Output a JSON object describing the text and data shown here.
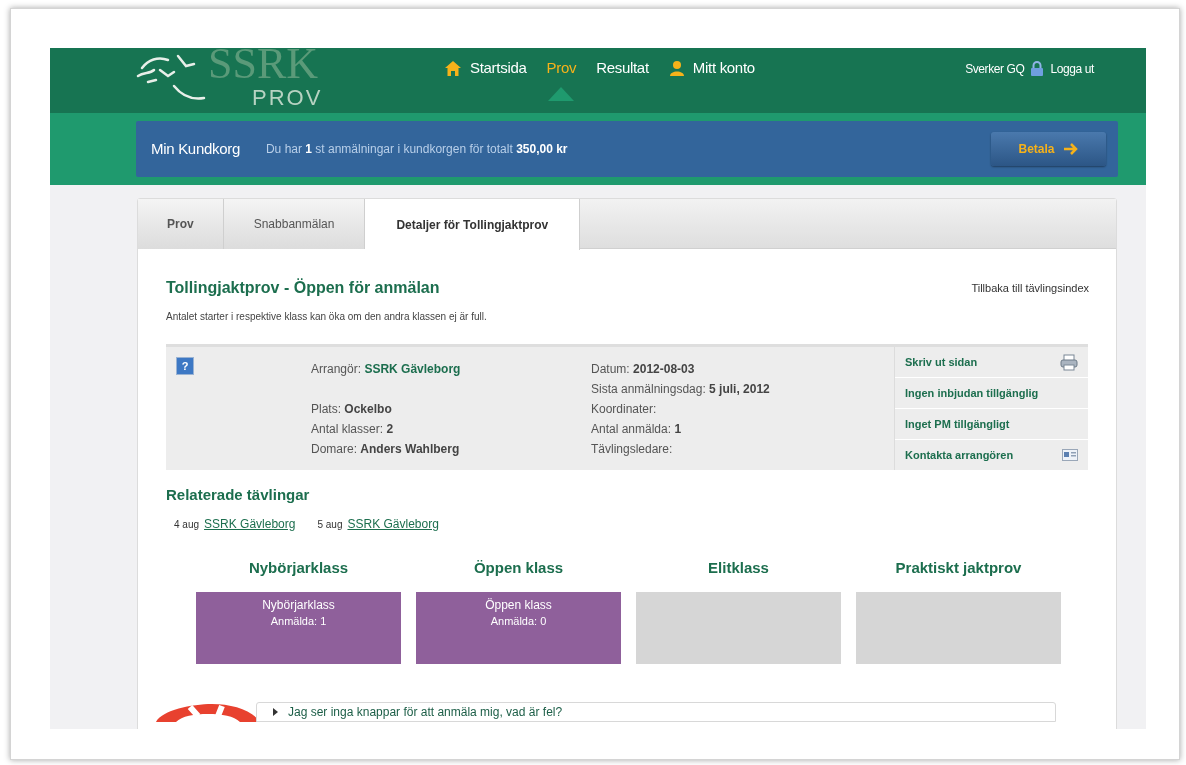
{
  "header": {
    "logo": {
      "title": "SSRK",
      "subtitle": "PROV"
    },
    "nav": [
      {
        "label": "Startsida",
        "kind": "home",
        "selected": false
      },
      {
        "label": "Prov",
        "kind": "plain",
        "selected": true
      },
      {
        "label": "Resultat",
        "kind": "plain",
        "selected": false
      },
      {
        "label": "Mitt konto",
        "kind": "account",
        "selected": false
      }
    ],
    "user": {
      "name": "Sverker GQ",
      "logout": "Logga ut"
    }
  },
  "cart": {
    "title": "Min Kundkorg",
    "message": "Du har **1** st anmälningar i kundkorgen för totalt **350,00 kr**",
    "button": "Betala"
  },
  "tabs": [
    {
      "label": "Prov",
      "selected": false
    },
    {
      "label": "Snabbanmälan",
      "selected": false
    },
    {
      "label": "Detaljer för Tollingjaktprov",
      "selected": true
    }
  ],
  "details": {
    "title": "Tollingjaktprov - Öppen för anmälan",
    "back_link": "Tillbaka till tävlingsindex",
    "note": "Antalet starter i respektive klass kan öka om den andra klassen ej är full.",
    "help_icon": "?",
    "left_fields": [
      {
        "label": "Arrangör:",
        "value": "SSRK Gävleborg",
        "kind": "link"
      },
      {
        "kind": "spacer"
      },
      {
        "label": "Plats:",
        "value": "Ockelbo",
        "kind": "text"
      },
      {
        "label": "Antal klasser:",
        "value": "2",
        "kind": "text"
      },
      {
        "label": "Domare:",
        "value": "Anders Wahlberg",
        "kind": "text"
      }
    ],
    "right_fields": [
      {
        "label": "Datum:",
        "value": "2012-08-03"
      },
      {
        "label": "Sista anmälningsdag:",
        "value": "5 juli, 2012"
      },
      {
        "label": "Koordinater:"
      },
      {
        "label": "Antal anmälda:",
        "value": "1"
      },
      {
        "label": "Tävlingsledare:"
      }
    ],
    "actions": [
      {
        "label": "Skriv ut sidan",
        "kind": "print"
      },
      {
        "label": "Ingen inbjudan tillgänglig",
        "kind": "plain"
      },
      {
        "label": "Inget PM tillgängligt",
        "kind": "plain"
      },
      {
        "label": "Kontakta arrangören",
        "kind": "contact"
      }
    ]
  },
  "related": {
    "title": "Relaterade tävlingar",
    "items": [
      {
        "date": "4 aug",
        "link": "SSRK Gävleborg"
      },
      {
        "date": "5 aug",
        "link": "SSRK Gävleborg"
      }
    ]
  },
  "classes": [
    {
      "title": "Nybörjarklass",
      "color": "#8f609b",
      "lines": [
        "Nybörjarklass",
        "Anmälda: 1"
      ]
    },
    {
      "title": "Öppen klass",
      "color": "#8f609b",
      "lines": [
        "Öppen klass",
        "Anmälda: 0"
      ]
    },
    {
      "title": "Elitklass",
      "color": "#d6d6d6"
    },
    {
      "title": "Praktiskt jaktprov",
      "color": "#d6d6d6"
    }
  ],
  "faq": {
    "question": "Jag ser inga knappar för att anmäla mig, vad är fel?"
  }
}
